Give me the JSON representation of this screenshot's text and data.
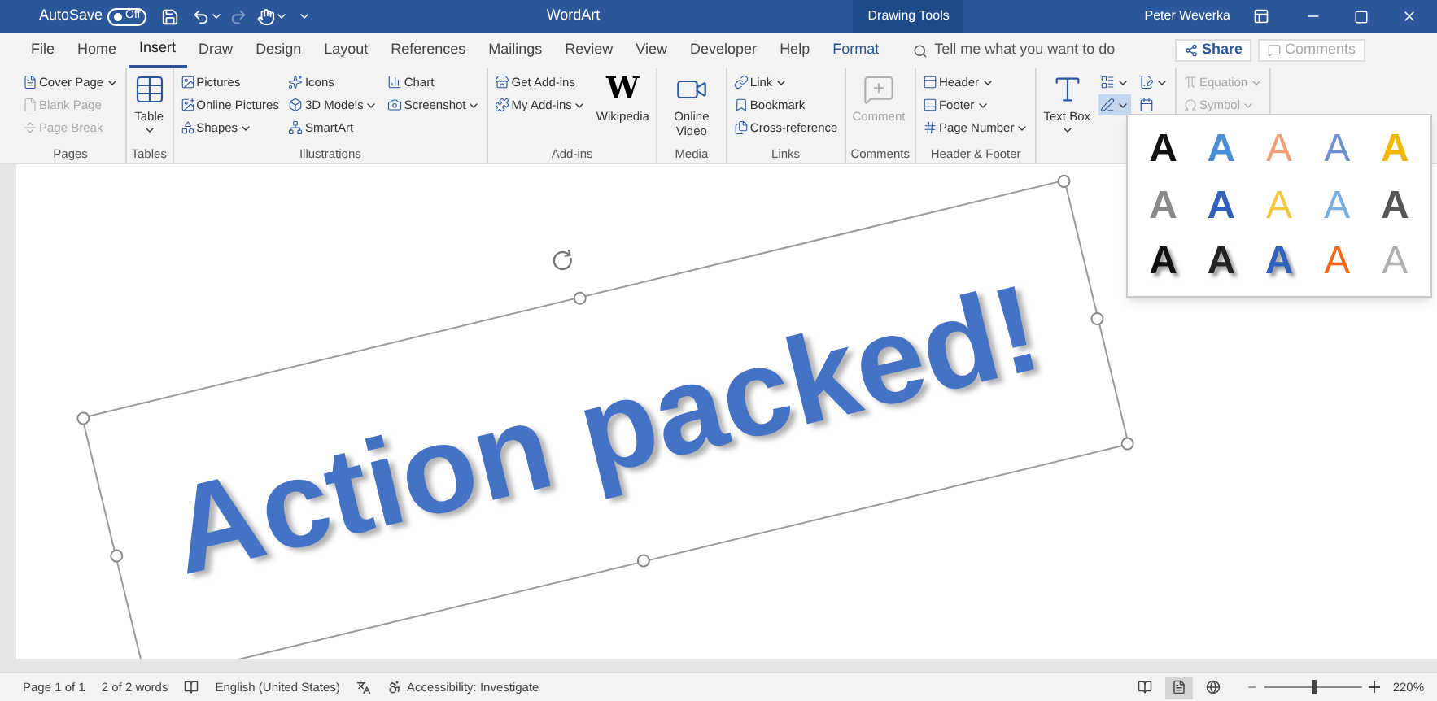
{
  "title_bar": {
    "autosave_label": "AutoSave",
    "autosave": {
      "on": false,
      "label": "Off"
    },
    "redo_disabled": true,
    "title": "WordArt",
    "context_header": "Drawing Tools",
    "user": "Peter Weverka"
  },
  "tabs": [
    {
      "label": "File",
      "selected": false
    },
    {
      "label": "Home",
      "selected": false
    },
    {
      "label": "Insert",
      "selected": true
    },
    {
      "label": "Draw",
      "selected": false
    },
    {
      "label": "Design",
      "selected": false
    },
    {
      "label": "Layout",
      "selected": false
    },
    {
      "label": "References",
      "selected": false
    },
    {
      "label": "Mailings",
      "selected": false
    },
    {
      "label": "Review",
      "selected": false
    },
    {
      "label": "View",
      "selected": false
    },
    {
      "label": "Developer",
      "selected": false
    },
    {
      "label": "Help",
      "selected": false
    },
    {
      "label": "Format",
      "selected": false,
      "kind": "contextual"
    }
  ],
  "search": {
    "placeholder": "Tell me what you want to do"
  },
  "share_button": "Share",
  "comments_button": {
    "label": "Comments",
    "disabled": true
  },
  "ribbon": {
    "groups": [
      {
        "label": "Pages",
        "columns": [
          {
            "kind": "stack",
            "items": [
              {
                "label": "Cover Page",
                "dropdown": true,
                "disabled": false
              },
              {
                "label": "Blank Page",
                "dropdown": false,
                "disabled": true
              },
              {
                "label": "Page Break",
                "dropdown": false,
                "disabled": true
              }
            ]
          }
        ]
      },
      {
        "label": "Tables",
        "columns": [
          {
            "kind": "large",
            "items": [
              {
                "label": "Table",
                "dropdown": true,
                "disabled": false
              }
            ]
          }
        ]
      },
      {
        "label": "Illustrations",
        "columns": [
          {
            "kind": "stack",
            "items": [
              {
                "label": "Pictures",
                "dropdown": false,
                "disabled": false
              },
              {
                "label": "Online Pictures",
                "dropdown": false,
                "disabled": false
              },
              {
                "label": "Shapes",
                "dropdown": true,
                "disabled": false
              }
            ]
          },
          {
            "kind": "stack",
            "items": [
              {
                "label": "Icons",
                "dropdown": false,
                "disabled": false
              },
              {
                "label": "3D Models",
                "dropdown": true,
                "disabled": false
              },
              {
                "label": "SmartArt",
                "dropdown": false,
                "disabled": false
              }
            ]
          },
          {
            "kind": "stack",
            "items": [
              {
                "label": "Chart",
                "dropdown": false,
                "disabled": false
              },
              {
                "label": "Screenshot",
                "dropdown": true,
                "disabled": false
              }
            ]
          }
        ]
      },
      {
        "label": "Add-ins",
        "columns": [
          {
            "kind": "stack",
            "items": [
              {
                "label": "Get Add-ins",
                "dropdown": false,
                "disabled": false
              },
              {
                "label": "My Add-ins",
                "dropdown": true,
                "disabled": false
              }
            ]
          },
          {
            "kind": "large",
            "items": [
              {
                "label": "Wikipedia",
                "logo": "W",
                "dropdown": false,
                "disabled": false
              }
            ]
          }
        ]
      },
      {
        "label": "Media",
        "columns": [
          {
            "kind": "large",
            "items": [
              {
                "label": "Online Video",
                "dropdown": false,
                "disabled": false
              }
            ]
          }
        ]
      },
      {
        "label": "Links",
        "columns": [
          {
            "kind": "stack",
            "items": [
              {
                "label": "Link",
                "dropdown": true,
                "disabled": false
              },
              {
                "label": "Bookmark",
                "dropdown": false,
                "disabled": false
              },
              {
                "label": "Cross-reference",
                "dropdown": false,
                "disabled": false
              }
            ]
          }
        ]
      },
      {
        "label": "Comments",
        "columns": [
          {
            "kind": "large",
            "items": [
              {
                "label": "Comment",
                "dropdown": false,
                "disabled": true
              }
            ]
          }
        ]
      },
      {
        "label": "Header & Footer",
        "columns": [
          {
            "kind": "stack",
            "items": [
              {
                "label": "Header",
                "dropdown": true,
                "disabled": false
              },
              {
                "label": "Footer",
                "dropdown": true,
                "disabled": false
              },
              {
                "label": "Page Number",
                "dropdown": true,
                "disabled": false
              }
            ]
          }
        ]
      },
      {
        "columns": [
          {
            "kind": "large",
            "items": [
              {
                "label": "Text Box",
                "dropdown": true,
                "disabled": false
              }
            ]
          },
          {
            "kind": "stack",
            "items": [
              {
                "dropdown": true,
                "disabled": false
              },
              {
                "dropdown": true,
                "disabled": false,
                "expanded": true
              }
            ]
          },
          {
            "kind": "stack",
            "items": [
              {
                "dropdown": true,
                "disabled": false
              },
              {
                "dropdown": false,
                "disabled": false
              }
            ]
          }
        ]
      },
      {
        "columns": [
          {
            "kind": "stack",
            "items": [
              {
                "label": "Equation",
                "dropdown": true,
                "disabled": true
              },
              {
                "label": "Symbol",
                "dropdown": true,
                "disabled": true
              }
            ]
          }
        ]
      }
    ]
  },
  "wordart_gallery": {
    "styles": [
      {
        "letter": "A",
        "kind": "solid",
        "color": "#111111"
      },
      {
        "letter": "A",
        "kind": "solid",
        "color": "#4a90d9"
      },
      {
        "letter": "A",
        "kind": "outline",
        "color": "#f0a07a"
      },
      {
        "letter": "A",
        "kind": "outline",
        "color": "#6f8fd0"
      },
      {
        "letter": "A",
        "kind": "solid",
        "color": "#f2b800"
      },
      {
        "letter": "A",
        "kind": "solid",
        "color": "#8a8a8a"
      },
      {
        "letter": "A",
        "kind": "solid",
        "color": "#2f5fbf"
      },
      {
        "letter": "A",
        "kind": "outline",
        "color": "#f5c842"
      },
      {
        "letter": "A",
        "kind": "outline",
        "color": "#7aaee0"
      },
      {
        "letter": "A",
        "kind": "solid",
        "color": "#555555"
      },
      {
        "letter": "A",
        "kind": "shadow",
        "color": "#111111"
      },
      {
        "letter": "A",
        "kind": "shadow",
        "color": "#222222"
      },
      {
        "letter": "A",
        "kind": "shadow",
        "color": "#2f5fbf"
      },
      {
        "letter": "A",
        "kind": "outline",
        "color": "#f06a1a"
      },
      {
        "letter": "A",
        "kind": "outline",
        "color": "#b0b0b0"
      }
    ]
  },
  "wordart": {
    "text": "Action packed!"
  },
  "status_bar": {
    "page": "Page 1 of 1",
    "words": "2 of 2 words",
    "language": "English (United States)",
    "accessibility": "Accessibility: Investigate",
    "views": [
      {
        "selected": false
      },
      {
        "selected": true
      },
      {
        "selected": false
      }
    ],
    "zoom": {
      "level": 0.5,
      "label": "220%"
    }
  }
}
